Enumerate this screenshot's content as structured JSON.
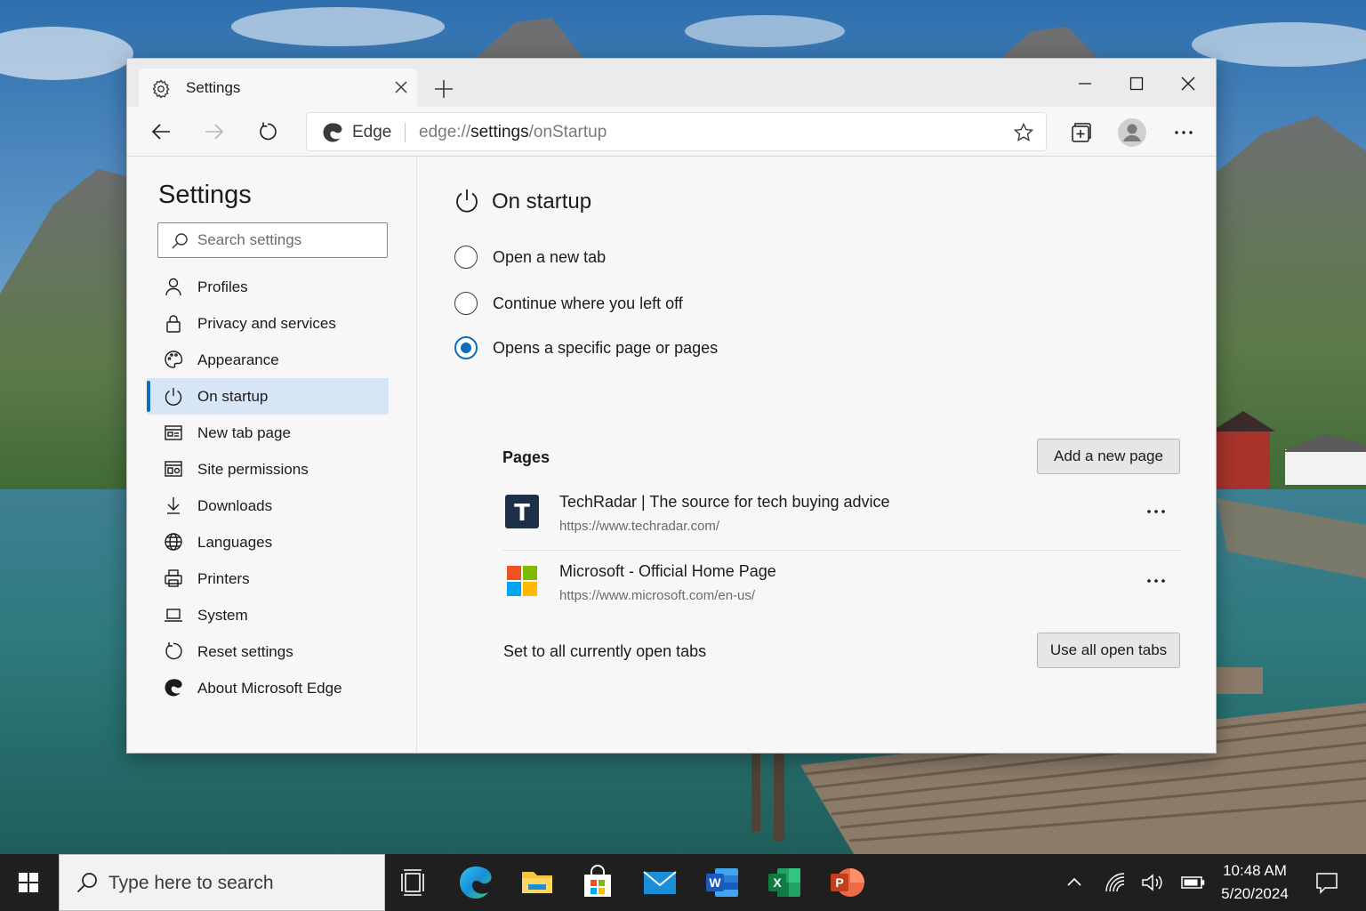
{
  "browser": {
    "tab": {
      "title": "Settings"
    },
    "address": {
      "brand": "Edge",
      "url_prefix": "edge://",
      "url_host": "settings",
      "url_path": "/onStartup"
    }
  },
  "sidebar": {
    "title": "Settings",
    "search_placeholder": "Search settings",
    "items": [
      {
        "label": "Profiles",
        "icon": "person-icon"
      },
      {
        "label": "Privacy and services",
        "icon": "lock-icon"
      },
      {
        "label": "Appearance",
        "icon": "palette-icon"
      },
      {
        "label": "On startup",
        "icon": "power-icon",
        "active": true
      },
      {
        "label": "New tab page",
        "icon": "new-tab-page-icon"
      },
      {
        "label": "Site permissions",
        "icon": "site-permissions-icon"
      },
      {
        "label": "Downloads",
        "icon": "download-icon"
      },
      {
        "label": "Languages",
        "icon": "globe-icon"
      },
      {
        "label": "Printers",
        "icon": "printer-icon"
      },
      {
        "label": "System",
        "icon": "laptop-icon"
      },
      {
        "label": "Reset settings",
        "icon": "reset-icon"
      },
      {
        "label": "About Microsoft Edge",
        "icon": "edge-logo-icon"
      }
    ]
  },
  "main": {
    "heading": "On startup",
    "options": [
      {
        "label": "Open a new tab",
        "checked": false
      },
      {
        "label": "Continue where you left off",
        "checked": false
      },
      {
        "label": "Opens a specific page or pages",
        "checked": true
      }
    ],
    "pages_label": "Pages",
    "add_page_button": "Add a new page",
    "pages": [
      {
        "title": "TechRadar | The source for tech buying advice",
        "url": "https://www.techradar.com/",
        "favicon": "techradar-favicon"
      },
      {
        "title": "Microsoft - Official Home Page",
        "url": "https://www.microsoft.com/en-us/",
        "favicon": "microsoft-favicon"
      }
    ],
    "set_all_label": "Set to all currently open tabs",
    "use_all_button": "Use all open tabs"
  },
  "taskbar": {
    "search_placeholder": "Type here to search",
    "apps": [
      "task-view-icon",
      "edge-icon",
      "file-explorer-icon",
      "store-icon",
      "mail-icon",
      "word-icon",
      "excel-icon",
      "powerpoint-icon"
    ],
    "time": "10:48 AM",
    "date": "5/20/2024"
  },
  "colors": {
    "accent": "#0f6cbd",
    "active_nav_bg": "#d6e6f4",
    "taskbar": "#1f1f1f"
  }
}
